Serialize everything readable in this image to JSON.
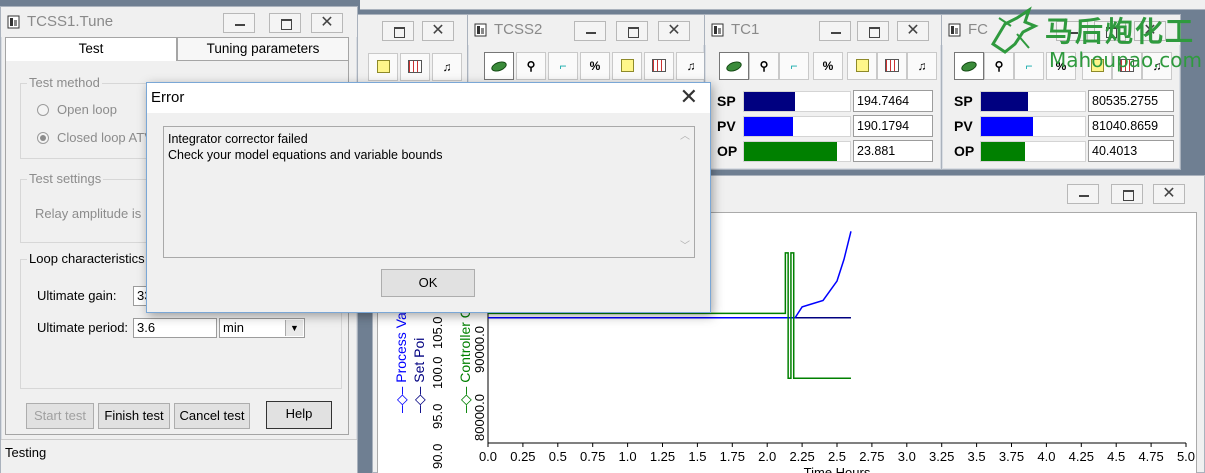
{
  "tune_window": {
    "title": "TCSS1.Tune",
    "tabs": [
      "Test",
      "Tuning parameters"
    ],
    "test_method": {
      "label": "Test method",
      "options": [
        "Open loop",
        "Closed loop ATV"
      ]
    },
    "test_settings": {
      "label": "Test settings",
      "relay_amplitude_label": "Relay amplitude is"
    },
    "loop_characteristics": {
      "label": "Loop characteristics",
      "ultimate_gain_label": "Ultimate gain:",
      "ultimate_gain_value": "33",
      "ultimate_period_label": "Ultimate period:",
      "ultimate_period_value": "3.6",
      "period_unit": "min"
    },
    "buttons": {
      "start": "Start test",
      "finish": "Finish test",
      "cancel": "Cancel test",
      "help": "Help"
    },
    "status": "Testing"
  },
  "faceplates": [
    {
      "title": "TCSS2"
    },
    {
      "title": "TC1",
      "rows": [
        {
          "label": "SP",
          "value": "194.7464",
          "fill": 0.48,
          "color": "#000080"
        },
        {
          "label": "PV",
          "value": "190.1794",
          "fill": 0.46,
          "color": "#0000ff"
        },
        {
          "label": "OP",
          "value": "23.881",
          "fill": 0.88,
          "color": "#008000"
        }
      ]
    },
    {
      "title": "FC",
      "rows": [
        {
          "label": "SP",
          "value": "80535.2755",
          "fill": 0.45,
          "color": "#000080"
        },
        {
          "label": "PV",
          "value": "81040.8659",
          "fill": 0.5,
          "color": "#0000ff"
        },
        {
          "label": "OP",
          "value": "40.4013",
          "fill": 0.42,
          "color": "#008000"
        }
      ]
    }
  ],
  "toolbar_symbols": {
    "percent": "%",
    "music": "♫"
  },
  "dialog": {
    "title": "Error",
    "line1": "Integrator corrector failed",
    "line2": "Check your model equations and variable bounds",
    "ok": "OK"
  },
  "watermark": {
    "cn": "马后炮化工",
    "url": "Mahoupao.com"
  },
  "chart_data": {
    "type": "line",
    "xlabel": "Time Hours",
    "x_ticks": [
      "0.0",
      "0.25",
      "0.5",
      "0.75",
      "1.0",
      "1.25",
      "1.5",
      "1.75",
      "2.0",
      "2.25",
      "2.5",
      "2.75",
      "3.0",
      "3.25",
      "3.5",
      "3.75",
      "4.0",
      "4.25",
      "4.5",
      "4.75",
      "5.0"
    ],
    "xlim": [
      0,
      5.0
    ],
    "y_axes": [
      {
        "label": "Process Va",
        "color": "#0000ff",
        "ticks": [
          "90.0",
          "95.0",
          "100.0",
          "105.0",
          "01"
        ]
      },
      {
        "label": "Set Poi",
        "color": "#000080"
      },
      {
        "label": "Controller Ou",
        "color": "#008000",
        "ticks": [
          "80000.0",
          "90000.0",
          "00000.0"
        ]
      }
    ],
    "series": [
      {
        "name": "",
        "color": "#000080",
        "x": [
          0,
          2.6
        ],
        "y": [
          0.58,
          0.58
        ]
      },
      {
        "name": "",
        "color": "#0000ff",
        "x": [
          0,
          2.2,
          2.22,
          2.25,
          2.3,
          2.4,
          2.5,
          2.55,
          2.6
        ],
        "y": [
          0.58,
          0.58,
          0.6,
          0.63,
          0.64,
          0.66,
          0.75,
          0.85,
          0.98
        ]
      },
      {
        "name": "",
        "color": "#008000",
        "x": [
          0,
          2.13,
          2.13,
          2.15,
          2.15,
          2.17,
          2.17,
          2.19,
          2.19,
          2.22,
          2.22,
          2.6
        ],
        "y": [
          0.6,
          0.6,
          0.88,
          0.88,
          0.3,
          0.3,
          0.88,
          0.88,
          0.3,
          0.3,
          0.3,
          0.3
        ]
      }
    ]
  }
}
